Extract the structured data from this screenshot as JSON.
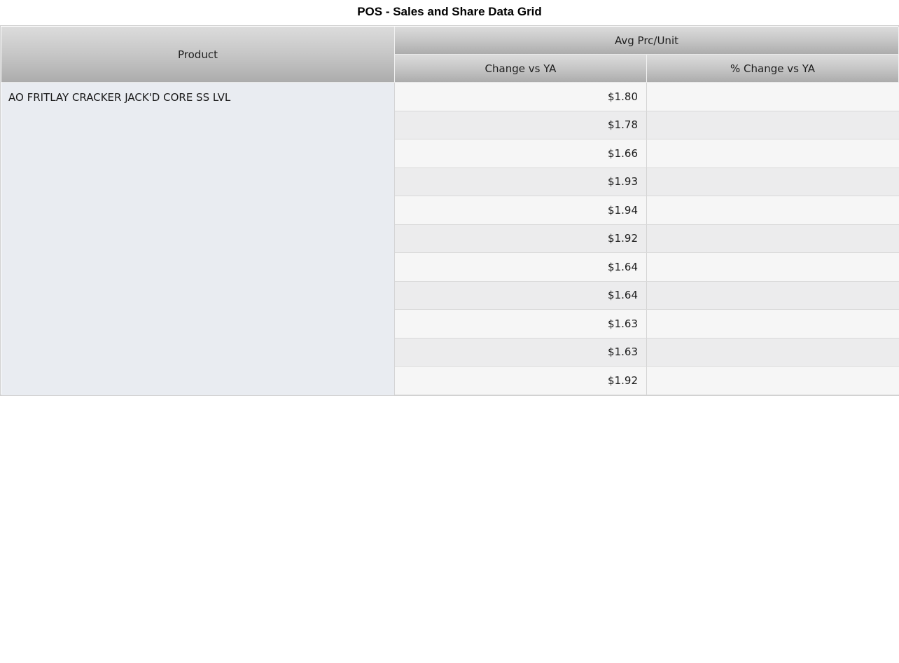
{
  "page": {
    "title": "POS - Sales and Share Data Grid"
  },
  "grid": {
    "headers": {
      "product": "Product",
      "group": "Avg Prc/Unit",
      "change": "Change vs YA",
      "pct_change": "% Change vs YA"
    },
    "product_name": "AO FRITLAY CRACKER JACK'D CORE SS LVL",
    "rows": [
      {
        "change": "$1.80",
        "pct_change": ""
      },
      {
        "change": "$1.78",
        "pct_change": ""
      },
      {
        "change": "$1.66",
        "pct_change": ""
      },
      {
        "change": "$1.93",
        "pct_change": ""
      },
      {
        "change": "$1.94",
        "pct_change": ""
      },
      {
        "change": "$1.92",
        "pct_change": ""
      },
      {
        "change": "$1.64",
        "pct_change": ""
      },
      {
        "change": "$1.64",
        "pct_change": ""
      },
      {
        "change": "$1.63",
        "pct_change": ""
      },
      {
        "change": "$1.63",
        "pct_change": ""
      },
      {
        "change": "$1.92",
        "pct_change": ""
      }
    ]
  }
}
